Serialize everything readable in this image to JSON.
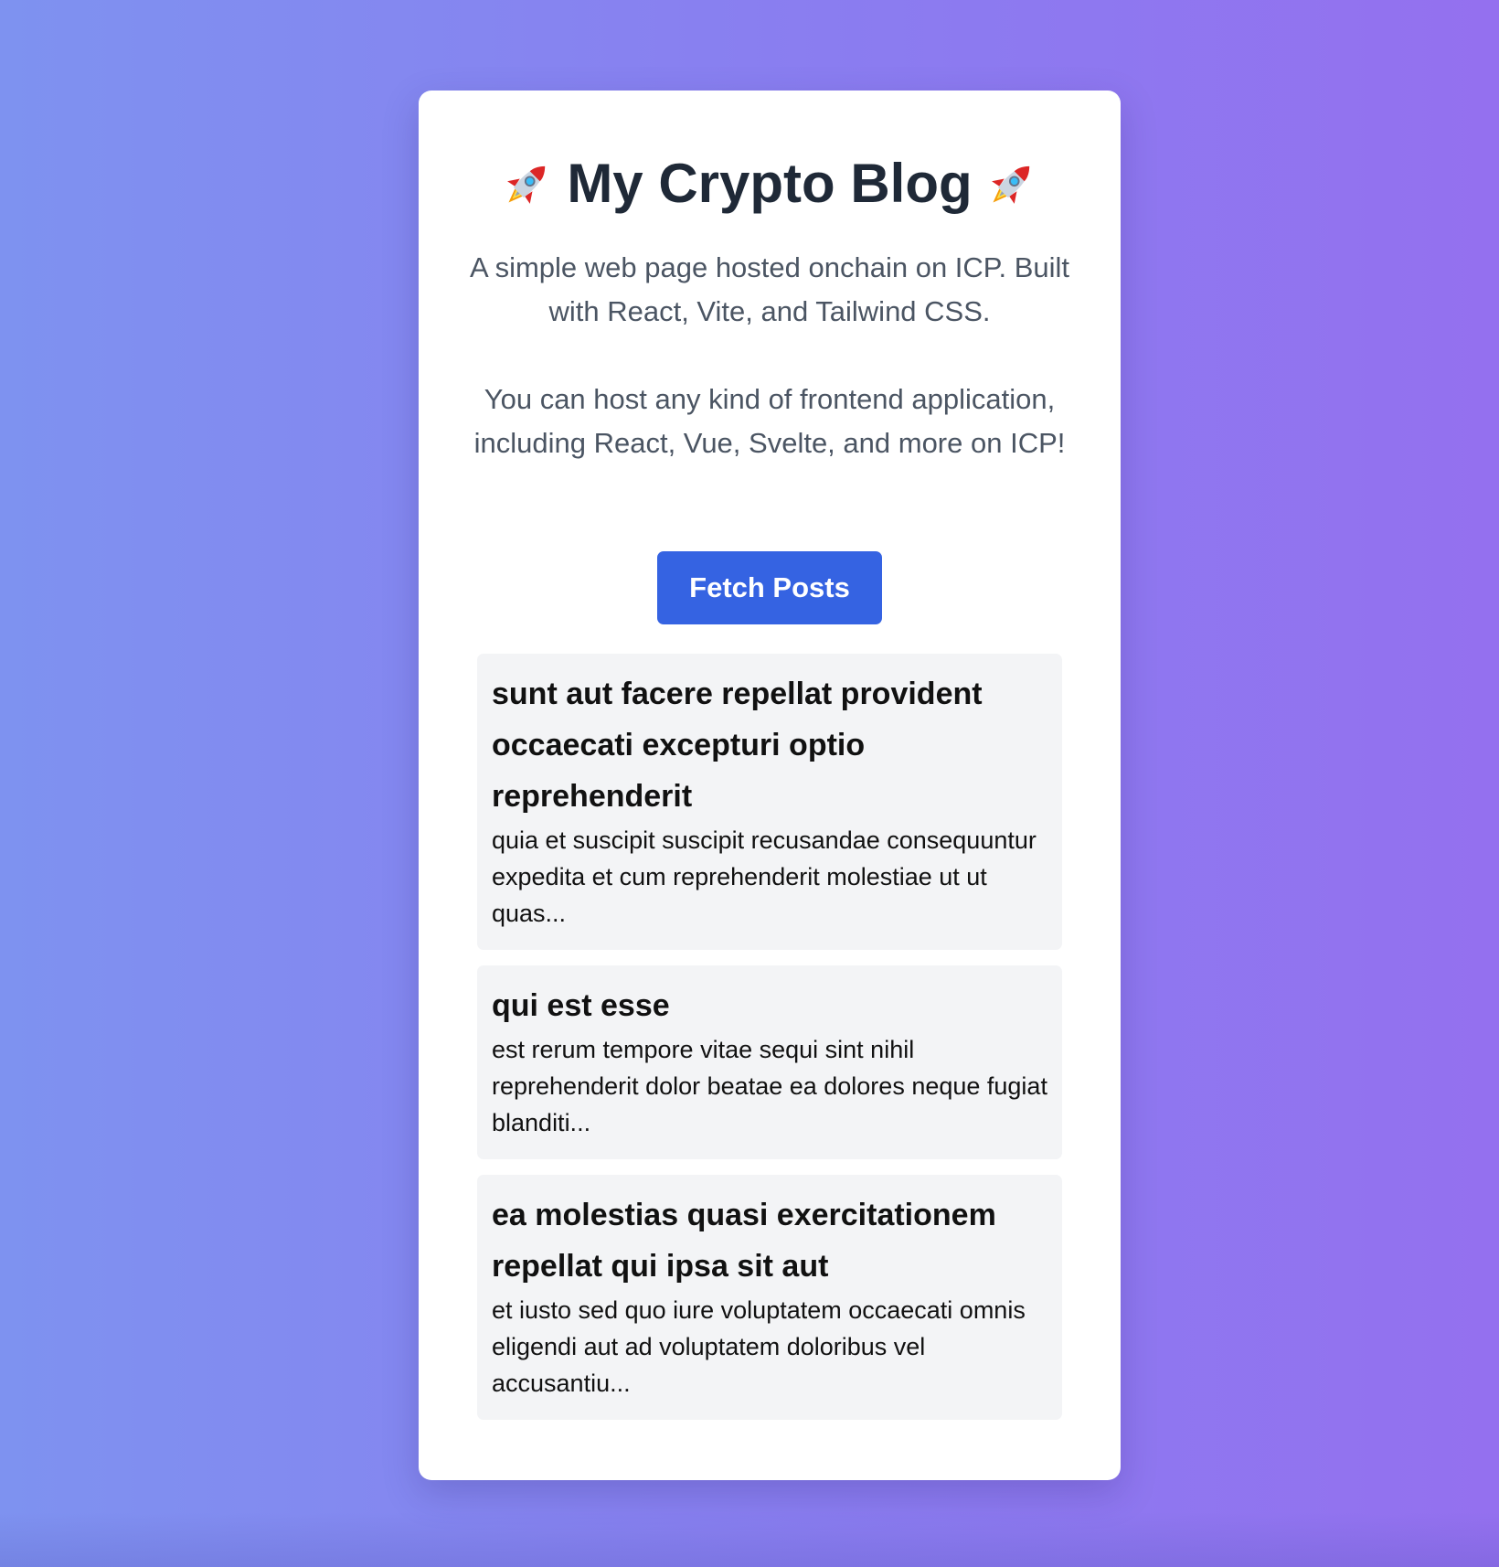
{
  "header": {
    "title": "My Crypto Blog",
    "rocket_icon": "rocket-icon"
  },
  "description": {
    "line1": "A simple web page hosted onchain on ICP. Built with React, Vite, and Tailwind CSS.",
    "line2": "You can host any kind of frontend application, including React, Vue, Svelte, and more on ICP!"
  },
  "actions": {
    "fetch_label": "Fetch Posts"
  },
  "posts": [
    {
      "title": "sunt aut facere repellat provident occaecati excepturi optio reprehenderit",
      "body": "quia et suscipit suscipit recusandae consequuntur expedita et cum reprehenderit molestiae ut ut quas..."
    },
    {
      "title": "qui est esse",
      "body": "est rerum tempore vitae sequi sint nihil reprehenderit dolor beatae ea dolores neque fugiat blanditi..."
    },
    {
      "title": "ea molestias quasi exercitationem repellat qui ipsa sit aut",
      "body": "et iusto sed quo iure voluptatem occaecati omnis eligendi aut ad voluptatem doloribus vel accusantiu..."
    }
  ],
  "colors": {
    "accent": "#3563e2",
    "title_text": "#1f2937",
    "muted_text": "#4b5563",
    "post_bg": "#f3f4f6"
  }
}
